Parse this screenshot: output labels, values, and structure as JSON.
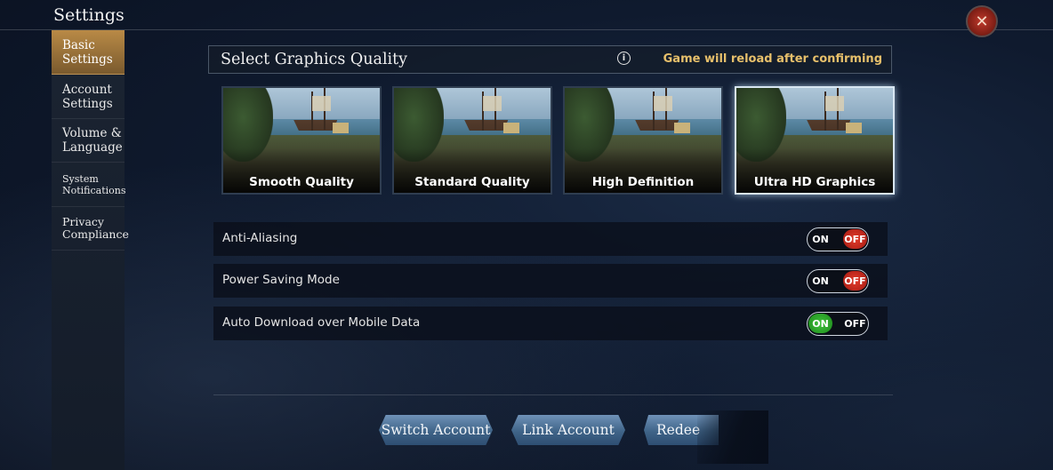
{
  "window": {
    "title": "Settings"
  },
  "close_icon": "close-x-icon",
  "sidebar": {
    "items": [
      {
        "label": "Basic\nSettings",
        "line1": "Basic",
        "line2": "Settings",
        "active": true
      },
      {
        "label": "Account\nSettings",
        "line1": "Account",
        "line2": "Settings",
        "active": false
      },
      {
        "label": "Volume &\nLanguage",
        "line1": "Volume &",
        "line2": "Language",
        "active": false
      },
      {
        "label": "System\nNotifications",
        "line1": "System",
        "line2": "Notifications",
        "active": false
      },
      {
        "label": "Privacy\nCompliance",
        "line1": "Privacy",
        "line2": "Compliance",
        "active": false
      }
    ]
  },
  "graphics": {
    "title": "Select Graphics Quality",
    "info_icon": "info-icon",
    "note": "Game will reload after confirming",
    "options": [
      {
        "label": "Smooth Quality",
        "selected": false
      },
      {
        "label": "Standard Quality",
        "selected": false
      },
      {
        "label": "High Definition",
        "selected": false
      },
      {
        "label": "Ultra HD Graphics",
        "selected": true
      }
    ]
  },
  "settings": [
    {
      "label": "Anti-Aliasing",
      "on_label": "ON",
      "off_label": "OFF",
      "state": "OFF"
    },
    {
      "label": "Power Saving Mode",
      "on_label": "ON",
      "off_label": "OFF",
      "state": "OFF"
    },
    {
      "label": "Auto Download over Mobile Data",
      "on_label": "ON",
      "off_label": "OFF",
      "state": "ON"
    }
  ],
  "actions": {
    "switch_account": "Switch Account",
    "link_account": "Link Account",
    "redeem": "Redee"
  },
  "colors": {
    "accent_gold": "#e7c06b",
    "active_tab": "#b98a46",
    "toggle_on": "#3ec23a",
    "toggle_off": "#e23b2b",
    "button_blue": "#4f74a0"
  }
}
